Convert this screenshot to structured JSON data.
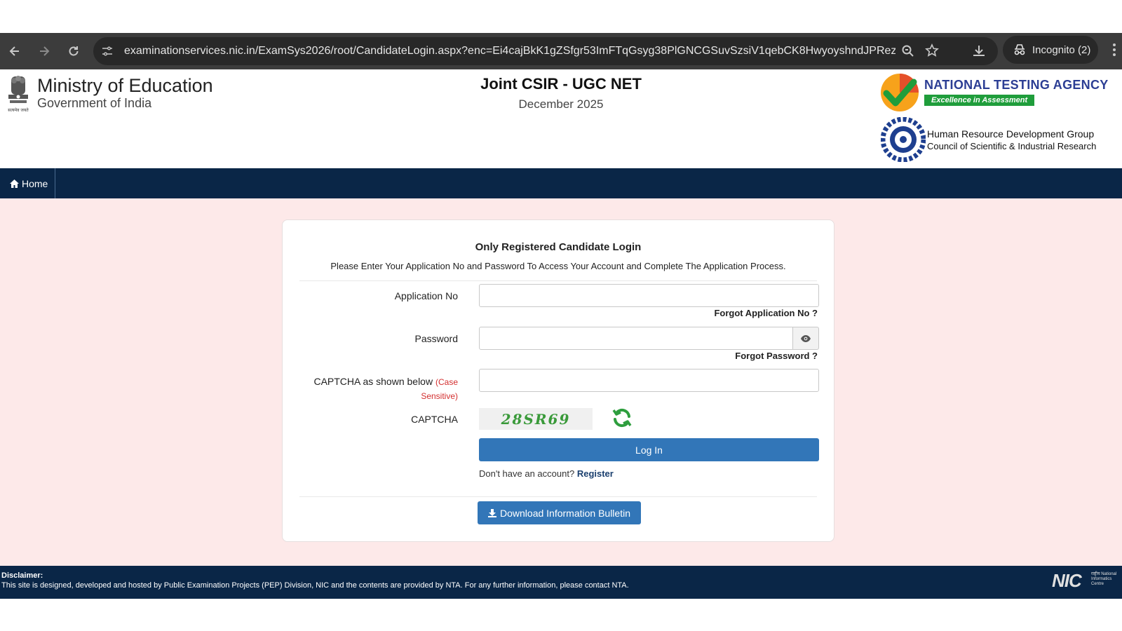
{
  "browser": {
    "url": "examinationservices.nic.in/ExamSys2026/root/CandidateLogin.aspx?enc=Ei4cajBkK1gZSfgr53ImFTqGsyg38PlGNCGSuvSzsiV1qebCK8HwyoyshndJPRez",
    "incognito_label": "Incognito (2)"
  },
  "header": {
    "ministry_title": "Ministry of Education",
    "ministry_sub": "Government of India",
    "emblem_motto": "सत्यमेव जयते",
    "exam_title": "Joint CSIR - UGC NET",
    "exam_session": "December 2025",
    "nta_title": "NATIONAL TESTING AGENCY",
    "nta_tagline": "Excellence in Assessment",
    "csir_line1": "Human Resource Development Group",
    "csir_line2": "Council of Scientific & Industrial Research"
  },
  "navbar": {
    "home_label": "Home"
  },
  "login": {
    "title": "Only Registered Candidate Login",
    "description": "Please Enter Your Application No and Password To Access Your Account and Complete The Application Process.",
    "app_no_label": "Application No",
    "forgot_app_no": "Forgot Application No ?",
    "password_label": "Password",
    "forgot_password": "Forgot Password ?",
    "captcha_input_label": "CAPTCHA as shown below",
    "case_sensitive_1": "(Case",
    "case_sensitive_2": "Sensitive)",
    "captcha_label": "CAPTCHA",
    "captcha_text": "28SR69",
    "login_button": "Log In",
    "no_account": "Don't have an account?",
    "register_link": "Register",
    "download_bulletin": "Download Information Bulletin"
  },
  "footer": {
    "disclaimer_title": "Disclaimer:",
    "disclaimer_text": "This site is designed, developed and hosted by Public Examination Projects (PEP) Division, NIC and the contents are provided by NTA. For any further information, please contact NTA.",
    "nic_logo_text": "NIC",
    "nic_small_text": "राष्ट्रीय National Informatics Centre"
  },
  "colors": {
    "browser_bar": "#3c3c3c",
    "navbar": "#0a2647",
    "content_bg": "#fde9e9",
    "primary_button": "#3276b8",
    "nta_blue": "#2c3e94",
    "nta_green": "#1f9d3b"
  }
}
